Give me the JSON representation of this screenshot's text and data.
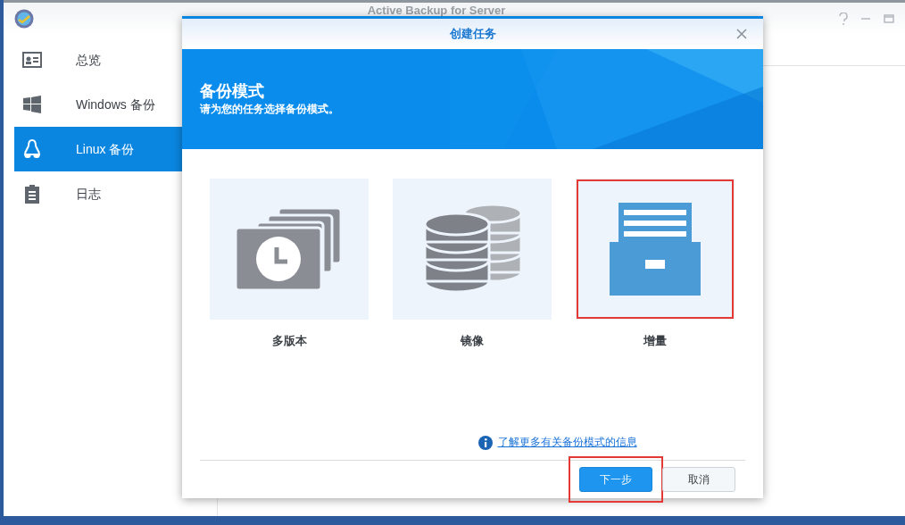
{
  "window": {
    "title": "Active Backup for Server"
  },
  "sidebar": {
    "items": [
      {
        "label": "总览",
        "kind": "overview",
        "selected": false
      },
      {
        "label": "Windows 备份",
        "kind": "windows",
        "selected": false
      },
      {
        "label": "Linux 备份",
        "kind": "linux",
        "selected": true
      },
      {
        "label": "日志",
        "kind": "log",
        "selected": false
      }
    ]
  },
  "dialog": {
    "title": "创建任务",
    "heading": "备份模式",
    "subheading": "请为您的任务选择备份模式。",
    "modes": [
      {
        "label": "多版本",
        "kind": "versions",
        "highlighted": false
      },
      {
        "label": "镜像",
        "kind": "mirror",
        "highlighted": false
      },
      {
        "label": "增量",
        "kind": "incremental",
        "highlighted": true
      }
    ],
    "link": "了解更多有关备份模式的信息",
    "buttons": [
      {
        "label": "下一步",
        "kind": "primary",
        "highlighted": true
      },
      {
        "label": "取消",
        "kind": "secondary",
        "highlighted": false
      }
    ]
  }
}
